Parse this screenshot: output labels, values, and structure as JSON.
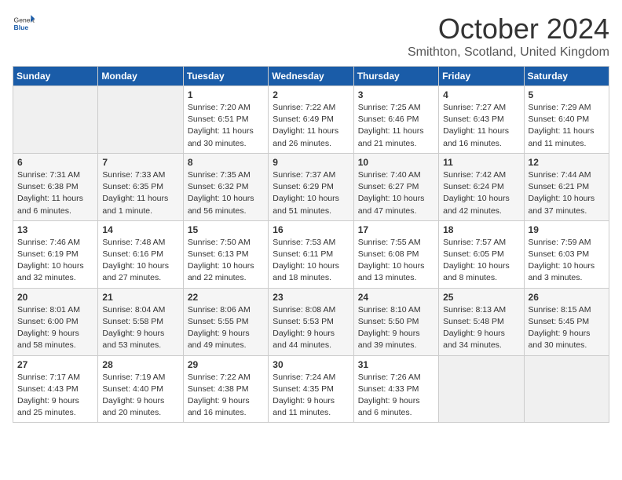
{
  "logo": {
    "general": "General",
    "blue": "Blue"
  },
  "title": "October 2024",
  "location": "Smithton, Scotland, United Kingdom",
  "headers": [
    "Sunday",
    "Monday",
    "Tuesday",
    "Wednesday",
    "Thursday",
    "Friday",
    "Saturday"
  ],
  "weeks": [
    [
      {
        "day": "",
        "detail": ""
      },
      {
        "day": "",
        "detail": ""
      },
      {
        "day": "1",
        "detail": "Sunrise: 7:20 AM\nSunset: 6:51 PM\nDaylight: 11 hours\nand 30 minutes."
      },
      {
        "day": "2",
        "detail": "Sunrise: 7:22 AM\nSunset: 6:49 PM\nDaylight: 11 hours\nand 26 minutes."
      },
      {
        "day": "3",
        "detail": "Sunrise: 7:25 AM\nSunset: 6:46 PM\nDaylight: 11 hours\nand 21 minutes."
      },
      {
        "day": "4",
        "detail": "Sunrise: 7:27 AM\nSunset: 6:43 PM\nDaylight: 11 hours\nand 16 minutes."
      },
      {
        "day": "5",
        "detail": "Sunrise: 7:29 AM\nSunset: 6:40 PM\nDaylight: 11 hours\nand 11 minutes."
      }
    ],
    [
      {
        "day": "6",
        "detail": "Sunrise: 7:31 AM\nSunset: 6:38 PM\nDaylight: 11 hours\nand 6 minutes."
      },
      {
        "day": "7",
        "detail": "Sunrise: 7:33 AM\nSunset: 6:35 PM\nDaylight: 11 hours\nand 1 minute."
      },
      {
        "day": "8",
        "detail": "Sunrise: 7:35 AM\nSunset: 6:32 PM\nDaylight: 10 hours\nand 56 minutes."
      },
      {
        "day": "9",
        "detail": "Sunrise: 7:37 AM\nSunset: 6:29 PM\nDaylight: 10 hours\nand 51 minutes."
      },
      {
        "day": "10",
        "detail": "Sunrise: 7:40 AM\nSunset: 6:27 PM\nDaylight: 10 hours\nand 47 minutes."
      },
      {
        "day": "11",
        "detail": "Sunrise: 7:42 AM\nSunset: 6:24 PM\nDaylight: 10 hours\nand 42 minutes."
      },
      {
        "day": "12",
        "detail": "Sunrise: 7:44 AM\nSunset: 6:21 PM\nDaylight: 10 hours\nand 37 minutes."
      }
    ],
    [
      {
        "day": "13",
        "detail": "Sunrise: 7:46 AM\nSunset: 6:19 PM\nDaylight: 10 hours\nand 32 minutes."
      },
      {
        "day": "14",
        "detail": "Sunrise: 7:48 AM\nSunset: 6:16 PM\nDaylight: 10 hours\nand 27 minutes."
      },
      {
        "day": "15",
        "detail": "Sunrise: 7:50 AM\nSunset: 6:13 PM\nDaylight: 10 hours\nand 22 minutes."
      },
      {
        "day": "16",
        "detail": "Sunrise: 7:53 AM\nSunset: 6:11 PM\nDaylight: 10 hours\nand 18 minutes."
      },
      {
        "day": "17",
        "detail": "Sunrise: 7:55 AM\nSunset: 6:08 PM\nDaylight: 10 hours\nand 13 minutes."
      },
      {
        "day": "18",
        "detail": "Sunrise: 7:57 AM\nSunset: 6:05 PM\nDaylight: 10 hours\nand 8 minutes."
      },
      {
        "day": "19",
        "detail": "Sunrise: 7:59 AM\nSunset: 6:03 PM\nDaylight: 10 hours\nand 3 minutes."
      }
    ],
    [
      {
        "day": "20",
        "detail": "Sunrise: 8:01 AM\nSunset: 6:00 PM\nDaylight: 9 hours\nand 58 minutes."
      },
      {
        "day": "21",
        "detail": "Sunrise: 8:04 AM\nSunset: 5:58 PM\nDaylight: 9 hours\nand 53 minutes."
      },
      {
        "day": "22",
        "detail": "Sunrise: 8:06 AM\nSunset: 5:55 PM\nDaylight: 9 hours\nand 49 minutes."
      },
      {
        "day": "23",
        "detail": "Sunrise: 8:08 AM\nSunset: 5:53 PM\nDaylight: 9 hours\nand 44 minutes."
      },
      {
        "day": "24",
        "detail": "Sunrise: 8:10 AM\nSunset: 5:50 PM\nDaylight: 9 hours\nand 39 minutes."
      },
      {
        "day": "25",
        "detail": "Sunrise: 8:13 AM\nSunset: 5:48 PM\nDaylight: 9 hours\nand 34 minutes."
      },
      {
        "day": "26",
        "detail": "Sunrise: 8:15 AM\nSunset: 5:45 PM\nDaylight: 9 hours\nand 30 minutes."
      }
    ],
    [
      {
        "day": "27",
        "detail": "Sunrise: 7:17 AM\nSunset: 4:43 PM\nDaylight: 9 hours\nand 25 minutes."
      },
      {
        "day": "28",
        "detail": "Sunrise: 7:19 AM\nSunset: 4:40 PM\nDaylight: 9 hours\nand 20 minutes."
      },
      {
        "day": "29",
        "detail": "Sunrise: 7:22 AM\nSunset: 4:38 PM\nDaylight: 9 hours\nand 16 minutes."
      },
      {
        "day": "30",
        "detail": "Sunrise: 7:24 AM\nSunset: 4:35 PM\nDaylight: 9 hours\nand 11 minutes."
      },
      {
        "day": "31",
        "detail": "Sunrise: 7:26 AM\nSunset: 4:33 PM\nDaylight: 9 hours\nand 6 minutes."
      },
      {
        "day": "",
        "detail": ""
      },
      {
        "day": "",
        "detail": ""
      }
    ]
  ]
}
